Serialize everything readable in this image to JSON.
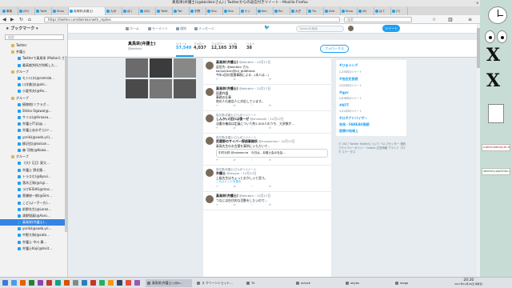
{
  "window": {
    "title": "真鳥栄(弁護士)(@bkirbkirさん) | Twitterからの返信付きツイート - Mozilla Firefox"
  },
  "tabs": [
    "事故",
    "(81)",
    "Twitt",
    "Shoo",
    "真鳥栄(弁護士)",
    "九州",
    "ぼく",
    "(82)",
    "Twitt",
    "Twi",
    "宇野",
    "Sho",
    "Sho",
    "ケン",
    "Ken",
    "Re:",
    "大ぎ",
    "Tru",
    "Airb",
    "Shoo",
    "(8)",
    "はて",
    "(7)"
  ],
  "nav": {
    "url": "https://twitter.com/bkirbkir/with_replies",
    "search_placeholder": "検索"
  },
  "sidebar": {
    "title": "ブックマーク",
    "search_placeholder": "検索",
    "items": [
      {
        "label": "Twitter",
        "type": "folder"
      },
      {
        "label": "弁護士",
        "type": "folder"
      },
      {
        "label": "Twitterで真鳥栄 (Maitori) さんが…",
        "type": "link"
      },
      {
        "label": "最高裁判所が判断した…",
        "type": "link"
      },
      {
        "label": "グループ",
        "type": "folder"
      },
      {
        "label": "モトロス(@ramrob…",
        "type": "link"
      },
      {
        "label": "川洋美法(@ahi…",
        "type": "link"
      },
      {
        "label": "小倉秀夫(@Ho…",
        "type": "link"
      },
      {
        "label": "グループ",
        "type": "folder"
      },
      {
        "label": "植物地(ソフラグ…",
        "type": "link"
      },
      {
        "label": "Shiiko Ogawa(@…",
        "type": "link"
      },
      {
        "label": "サイエ(@hiroasa…",
        "type": "link"
      },
      {
        "label": "弁護士IT法(@…",
        "type": "link"
      },
      {
        "label": "弁護士あおぞら(ド…",
        "type": "link"
      },
      {
        "label": "yoriki(@saeb.yri)…",
        "type": "link"
      },
      {
        "label": "柳沢信(@koisan…",
        "type": "link"
      },
      {
        "label": "森 可統(@Kowa…",
        "type": "link"
      },
      {
        "label": "グループ",
        "type": "folder"
      },
      {
        "label": "《大》【正】東大…",
        "type": "link"
      },
      {
        "label": "弁護士 野北勝…",
        "type": "link"
      },
      {
        "label": "トラスむ(@Kyosi…",
        "type": "link"
      },
      {
        "label": "落木正和(@rigi…",
        "type": "link"
      },
      {
        "label": "ラけIESUK(@mac…",
        "type": "link"
      },
      {
        "label": "黒瀬修一郎(@Sim…",
        "type": "link"
      },
      {
        "label": "こどん(ー子一方)…",
        "type": "link"
      },
      {
        "label": "前野先生(@Loroz…",
        "type": "link"
      },
      {
        "label": "清野翔真(@Aaro…",
        "type": "link"
      },
      {
        "label": "真鳥栄(弁護士)…",
        "type": "link",
        "selected": true
      },
      {
        "label": "yoriki(@saeb.yri…",
        "type": "link"
      },
      {
        "label": "中野大和(@sato…",
        "type": "link"
      },
      {
        "label": "弁護士 中川 康…",
        "type": "link"
      },
      {
        "label": "弁護士Kaji(@hisit…",
        "type": "link"
      }
    ]
  },
  "twitter_nav": {
    "home": "ホーム",
    "moments": "モーメント",
    "notifications": "通知",
    "messages": "メッセージ",
    "search_placeholder": "Twitterを検索",
    "tweet_button": "ツイート"
  },
  "profile": {
    "name": "真鳥栄(弁護士)",
    "handle": "@bkirbkir",
    "stats": [
      {
        "label": "ツイート",
        "value": "57,549"
      },
      {
        "label": "フォロー",
        "value": "4,037"
      },
      {
        "label": "フォロワー",
        "value": "12,165"
      },
      {
        "label": "いいね",
        "value": "378"
      },
      {
        "label": "リスト",
        "value": "38"
      }
    ],
    "follow_button": "フォローする"
  },
  "tweets": [
    {
      "retweeted_by": "",
      "name": "真鳥栄(弁護士)",
      "handle": "@bkirbkir・12月17日",
      "text": "返信先: @bkirbkir さん",
      "extra": "kanjukikun@lid_gtd8tidas",
      "body": "今年4回の国選事務による…(本人は…)",
      "counts": [
        "",
        "",
        "1",
        "",
        ""
      ],
      "quote": ""
    },
    {
      "retweeted_by": "",
      "name": "真鳥栄(弁護士)",
      "handle": "@bkirbkir・12月17日",
      "text": "国選弁護",
      "extra": "事務の仕事",
      "body": "他の人も被告人に対応しています。",
      "counts": [
        "",
        "",
        "1",
        "",
        ""
      ],
      "quote": ""
    },
    {
      "retweeted_by": "真鳥栄(弁護士)さんがリツイート",
      "name": "しんかい(旧):は復ーゼ",
      "handle": "@shinkai0r・12月17日",
      "text": "",
      "extra": "",
      "body": "法曹の養成は定員について約1,500人のうち、大多数が…",
      "counts": [
        "",
        "",
        "1",
        "",
        ""
      ],
      "quote": ""
    },
    {
      "retweeted_by": "真鳥栄(弁護士)さんがリツイート",
      "name": "武蔵野のサイバー探偵事務所",
      "handle": "@musashino・12月17日",
      "text": "",
      "extra": "",
      "body": "真鳥先生のお言葉を事例にいただいて…",
      "counts": [
        "",
        "",
        "",
        "",
        ""
      ],
      "quote": "中村元弥 @nakamura　今日は、弁護士会の社会…"
    },
    {
      "retweeted_by": "真鳥栄(弁護士)さんがリツイート",
      "name": "弁護士",
      "handle": "@lawyer・12月17日",
      "text": "",
      "extra": "",
      "body": "上級先生はちょっとおかしいと思う。",
      "counts": [
        "",
        "",
        "",
        "",
        ""
      ],
      "quote": "",
      "reply": "このスレッドを表示"
    },
    {
      "retweeted_by": "",
      "name": "真鳥栄(弁護士)",
      "handle": "@bkirbkir・12月17日",
      "text": "",
      "extra": "",
      "body": "つなには在住的な活動をしたいので…",
      "counts": [
        "",
        "",
        "",
        "",
        ""
      ],
      "quote": ""
    }
  ],
  "trends": [
    {
      "title": "#ひまメシデ",
      "count": "1,234件のツイート"
    },
    {
      "title": "#他会定長続",
      "count": "2,024件のツイート"
    },
    {
      "title": "#gpv",
      "count": "5,678件のツイート"
    },
    {
      "title": "#NTT",
      "count": "1,011件のツイート"
    },
    {
      "title": "#ロボアドバイザー",
      "count": ""
    },
    {
      "title": "安倍・FANEAU接続",
      "count": ""
    },
    {
      "title": "医療の地域上",
      "count": ""
    }
  ],
  "footer": "© 2017 Twitter  Twitterについて  ヘルプセンター  規約  プライバシーポリシー  Cookie  広告情報  ブランド  ブログ  ステータス",
  "taskbar": {
    "tasks": [
      {
        "label": "真鳥栄(弁護士) (@b…",
        "active": true
      },
      {
        "label": "ス クリーンショット…",
        "active": false
      },
      {
        "label": "Tk",
        "active": false
      },
      {
        "label": "xclock",
        "active": false
      },
      {
        "label": "xeyes",
        "active": false
      },
      {
        "label": "xlogo",
        "active": false
      }
    ],
    "time": "20:20",
    "date": "2017年12月18日(月曜日)"
  },
  "desktop": {
    "terms": [
      "x-termi-add-my-sh-my-k",
      "xterminy-sep2016v-2019t/1"
    ]
  },
  "colors": {
    "twitter_blue": "#1da1f2",
    "selection": "#3584e4",
    "text": "#14171a",
    "muted": "#657786"
  }
}
